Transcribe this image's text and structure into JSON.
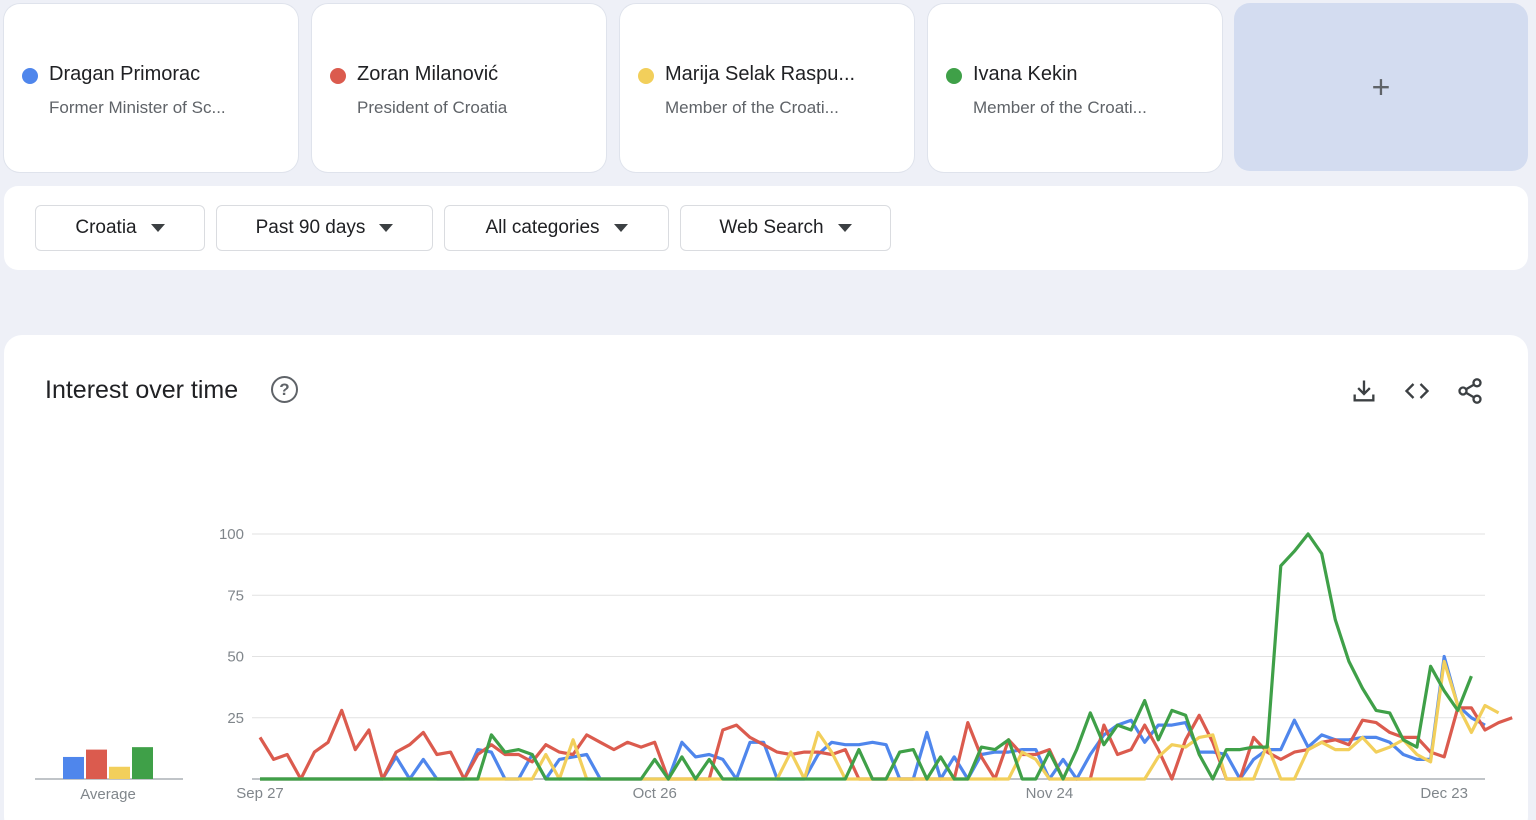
{
  "terms": [
    {
      "name": "Dragan Primorac",
      "description": "Former Minister of Sc...",
      "color": "#4f86ec"
    },
    {
      "name": "Zoran Milanović",
      "description": "President of Croatia",
      "color": "#db5b4e"
    },
    {
      "name": "Marija Selak Raspu...",
      "description": "Member of the Croati...",
      "color": "#f2cf5b"
    },
    {
      "name": "Ivana Kekin",
      "description": "Member of the Croati...",
      "color": "#3fa048"
    }
  ],
  "add_label": "+",
  "filters": {
    "region": "Croatia",
    "time": "Past 90 days",
    "category": "All categories",
    "property": "Web Search"
  },
  "chart_card": {
    "title": "Interest over time",
    "help_icon": "?",
    "icons": [
      "download-icon",
      "embed-icon",
      "share-icon"
    ]
  },
  "chart_data": {
    "type": "line",
    "ylim": [
      0,
      100
    ],
    "yticks": [
      "100",
      "75",
      "50",
      "25"
    ],
    "xticks": [
      {
        "label": "Sep 27",
        "index": 0
      },
      {
        "label": "Oct 26",
        "index": 29
      },
      {
        "label": "Nov 24",
        "index": 58
      },
      {
        "label": "Dec 23",
        "index": 87
      }
    ],
    "average_label": "Average",
    "averages": [
      9,
      12,
      5,
      13
    ],
    "series": [
      {
        "name": "Dragan Primorac",
        "color": "#4f86ec",
        "values": [
          0,
          0,
          0,
          0,
          0,
          0,
          0,
          0,
          0,
          0,
          9,
          0,
          8,
          0,
          0,
          0,
          12,
          11,
          0,
          0,
          10,
          0,
          8,
          9,
          10,
          0,
          0,
          0,
          0,
          0,
          0,
          15,
          9,
          10,
          8,
          0,
          15,
          15,
          0,
          0,
          0,
          10,
          15,
          14,
          14,
          15,
          14,
          0,
          0,
          19,
          0,
          9,
          0,
          10,
          11,
          11,
          12,
          12,
          0,
          8,
          0,
          10,
          18,
          22,
          24,
          15,
          22,
          22,
          23,
          11,
          11,
          10,
          0,
          8,
          12,
          12,
          24,
          13,
          18,
          16,
          16,
          17,
          17,
          15,
          10,
          8,
          8,
          50,
          30,
          25,
          22
        ]
      },
      {
        "name": "Zoran Milanović",
        "color": "#db5b4e",
        "values": [
          17,
          8,
          10,
          0,
          11,
          15,
          28,
          12,
          20,
          0,
          11,
          14,
          19,
          10,
          11,
          0,
          10,
          14,
          10,
          10,
          7,
          14,
          11,
          10,
          18,
          15,
          12,
          15,
          13,
          15,
          0,
          0,
          0,
          0,
          20,
          22,
          17,
          14,
          11,
          10,
          11,
          11,
          10,
          12,
          0,
          0,
          0,
          0,
          0,
          0,
          0,
          0,
          23,
          9,
          0,
          16,
          10,
          10,
          12,
          0,
          0,
          0,
          22,
          10,
          12,
          22,
          12,
          0,
          16,
          26,
          15,
          0,
          0,
          17,
          11,
          8,
          11,
          12,
          15,
          16,
          14,
          24,
          23,
          19,
          17,
          17,
          11,
          9,
          29,
          29,
          20,
          23,
          25
        ]
      },
      {
        "name": "Marija Selak Raspu...",
        "color": "#f2cf5b",
        "values": [
          0,
          0,
          0,
          0,
          0,
          0,
          0,
          0,
          0,
          0,
          0,
          0,
          0,
          0,
          0,
          0,
          0,
          0,
          0,
          0,
          0,
          10,
          0,
          16,
          0,
          0,
          0,
          0,
          0,
          0,
          0,
          0,
          0,
          0,
          0,
          0,
          0,
          0,
          0,
          11,
          0,
          19,
          11,
          0,
          0,
          0,
          0,
          0,
          0,
          0,
          0,
          0,
          0,
          0,
          0,
          0,
          11,
          8,
          0,
          0,
          0,
          0,
          0,
          0,
          0,
          0,
          9,
          14,
          13,
          17,
          18,
          0,
          0,
          0,
          14,
          0,
          0,
          12,
          15,
          12,
          12,
          17,
          11,
          13,
          16,
          10,
          7,
          48,
          30,
          19,
          30,
          27
        ]
      },
      {
        "name": "Ivana Kekin",
        "color": "#3fa048",
        "values": [
          0,
          0,
          0,
          0,
          0,
          0,
          0,
          0,
          0,
          0,
          0,
          0,
          0,
          0,
          0,
          0,
          0,
          18,
          11,
          12,
          10,
          0,
          0,
          0,
          0,
          0,
          0,
          0,
          0,
          8,
          0,
          9,
          0,
          8,
          0,
          0,
          0,
          0,
          0,
          0,
          0,
          0,
          0,
          0,
          12,
          0,
          0,
          11,
          12,
          0,
          9,
          0,
          0,
          13,
          12,
          16,
          0,
          0,
          11,
          0,
          12,
          27,
          14,
          22,
          20,
          32,
          16,
          28,
          26,
          10,
          0,
          12,
          12,
          13,
          13,
          87,
          93,
          100,
          92,
          65,
          48,
          37,
          28,
          27,
          16,
          13,
          46,
          36,
          28,
          42
        ]
      }
    ]
  }
}
